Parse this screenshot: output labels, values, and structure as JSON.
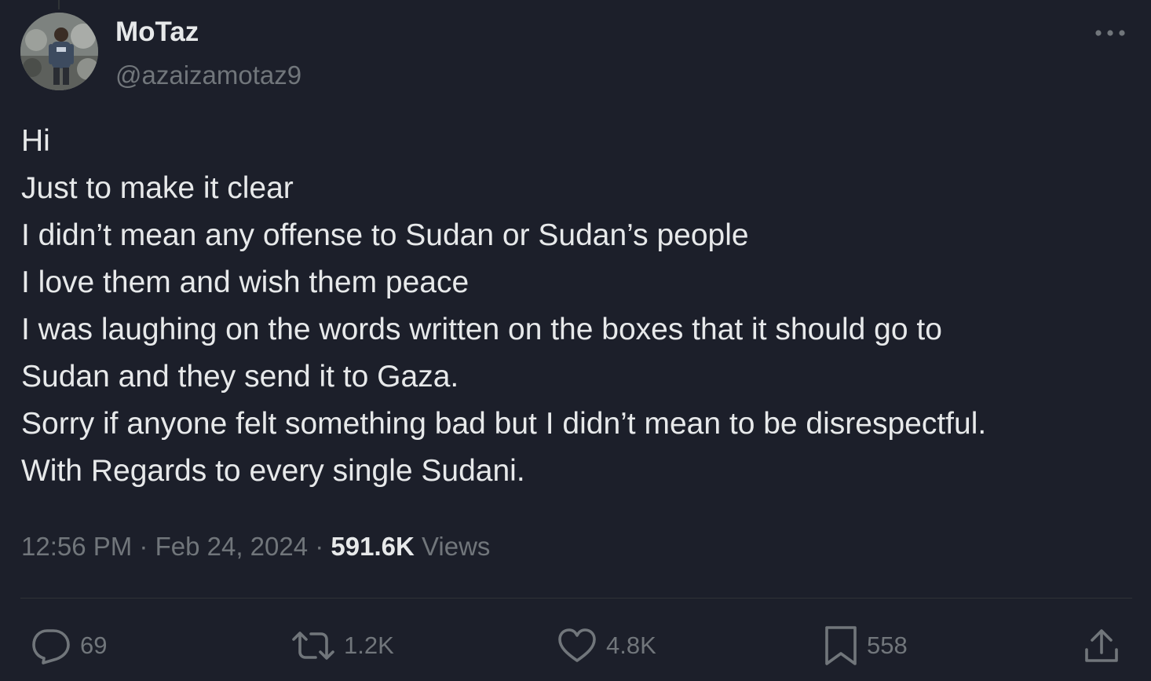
{
  "author": {
    "display_name": "MoTaz",
    "handle": "@azaizamotaz9"
  },
  "icons": {
    "more": "more-horizontal-icon",
    "reply": "reply-bubble-icon",
    "retweet": "retweet-icon",
    "like": "heart-icon",
    "bookmark": "bookmark-icon",
    "share": "share-upload-icon"
  },
  "tweet": {
    "lines": [
      "Hi",
      "Just to make it clear",
      "I didn’t mean any offense to Sudan or Sudan’s people",
      "I love them and wish them peace",
      "I was laughing on the words written on the boxes that it should go to",
      "Sudan and they send it to Gaza.",
      "Sorry if anyone felt something bad but I didn’t mean to be disrespectful.",
      "With Regards to every single Sudani."
    ],
    "time": "12:56 PM",
    "separator": " · ",
    "date": "Feb 24, 2024",
    "views_count": "591.6K",
    "views_label": "Views"
  },
  "actions": {
    "replies": "69",
    "retweets": "1.2K",
    "likes": "4.8K",
    "bookmarks": "558"
  },
  "colors": {
    "background": "#1c1f2a",
    "text_primary": "#e7e9ea",
    "text_secondary": "#71767b",
    "divider": "#2f3336"
  }
}
